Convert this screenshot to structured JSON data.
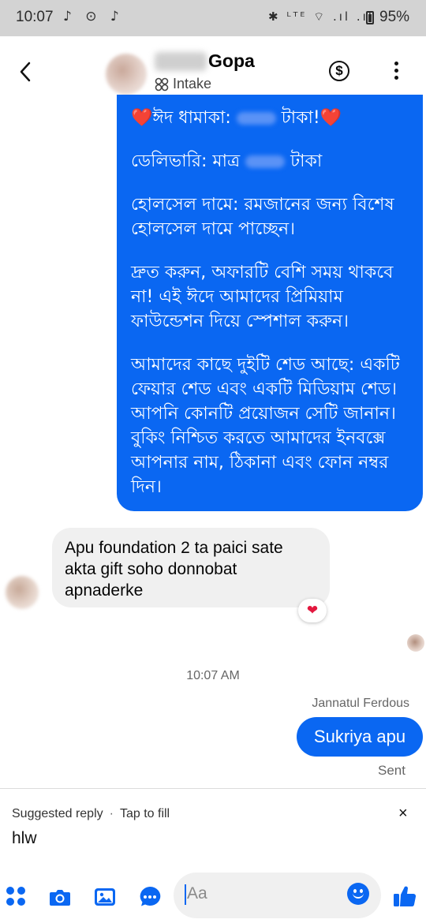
{
  "status_bar": {
    "time": "10:07",
    "left_icons": "♪ ⊙ ♪",
    "right_icons": "✱ ᴸᵀᴱ ⌔ .ıl .ıl",
    "battery": "95%"
  },
  "header": {
    "contact_name": "Gopa",
    "label_status": "Intake"
  },
  "messages": {
    "outgoing_long": {
      "p1_a": "❤️ঈদ ধামাকা: ",
      "p1_b": " টাকা!❤️",
      "p2_a": "ডেলিভারি: মাত্র ",
      "p2_b": " টাকা",
      "p3": "হোলসেল দামে: রমজানের জন্য বিশেষ হোলসেল দামে পাচ্ছেন।",
      "p4": "দ্রুত করুন, অফারটি বেশি সময় থাকবে না! এই ঈদে আমাদের প্রিমিয়াম ফাউন্ডেশন দিয়ে স্পেশাল করুন।",
      "p5": "আমাদের কাছে দুইটি শেড আছে: একটি ফেয়ার শেড এবং একটি মিডিয়াম শেড। আপনি কোনটি প্রয়োজন সেটি জানান। বুকিং নিশ্চিত করতে আমাদের ইনবক্সে আপনার নাম, ঠিকানা এবং ফোন নম্বর দিন।"
    },
    "incoming": {
      "text": "Apu foundation 2 ta paici sate akta gift soho donnobat apnaderke",
      "reaction": "❤"
    },
    "timestamp": "10:07 AM",
    "outgoing_short": {
      "sender": "Jannatul Ferdous",
      "text": "Sukriya apu",
      "status": "Sent"
    }
  },
  "suggested_reply": {
    "title": "Suggested reply",
    "hint": "Tap to fill",
    "close": "×",
    "text": "hlw"
  },
  "composer": {
    "placeholder": "Aa"
  },
  "colors": {
    "accent": "#0a67f2",
    "incoming_bubble": "#f0f0f0",
    "status_bar": "#d3d3d3"
  },
  "icons": [
    "back-icon",
    "intake-icon",
    "dollar-icon",
    "more-icon",
    "menu-dots-icon",
    "camera-icon",
    "gallery-icon",
    "chat-bubble-icon",
    "emoji-icon",
    "like-icon"
  ]
}
